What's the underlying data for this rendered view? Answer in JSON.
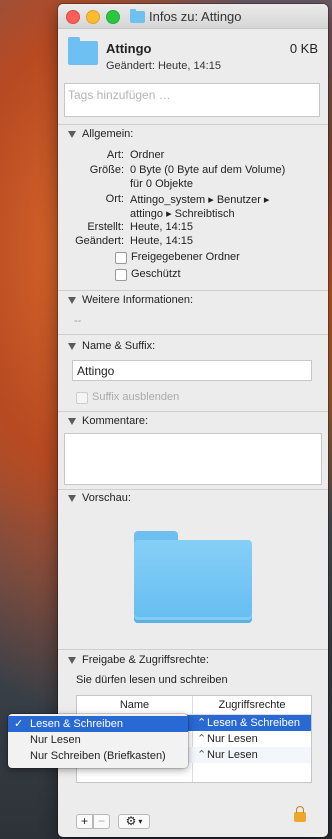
{
  "window_title": "Infos zu: Attingo",
  "header": {
    "name": "Attingo",
    "size": "0 KB",
    "modified": "Geändert: Heute, 14:15"
  },
  "tags_placeholder": "Tags hinzufügen …",
  "sections": {
    "general": "Allgemein:",
    "more_info": "Weitere Informationen:",
    "name_suffix": "Name & Suffix:",
    "comments": "Kommentare:",
    "preview": "Vorschau:",
    "sharing": "Freigabe & Zugriffsrechte:"
  },
  "general": {
    "kind_k": "Art:",
    "kind_v": "Ordner",
    "size_k": "Größe:",
    "size_v1": "0 Byte (0 Byte auf dem Volume)",
    "size_v2": "für 0 Objekte",
    "where_k": "Ort:",
    "where_v1": "Attingo_system ▸ Benutzer ▸",
    "where_v2": "attingo ▸ Schreibtisch",
    "created_k": "Erstellt:",
    "created_v": "Heute, 14:15",
    "modified_k": "Geändert:",
    "modified_v": "Heute, 14:15",
    "shared_folder": "Freigegebener Ordner",
    "locked": "Geschützt"
  },
  "more_info_value": "--",
  "name_field": "Attingo",
  "hide_extension": "Suffix ausblenden",
  "sharing": {
    "note": "Sie dürfen lesen und schreiben",
    "col_name": "Name",
    "col_priv": "Zugriffsrechte",
    "rows": [
      "Lesen & Schreiben",
      "Nur Lesen",
      "Nur Lesen"
    ]
  },
  "popup": {
    "items": [
      "Lesen & Schreiben",
      "Nur Lesen",
      "Nur Schreiben (Briefkasten)"
    ],
    "selected": 0
  },
  "colors": {
    "accent": "#2869d3",
    "folder": "#6ec0f2"
  }
}
